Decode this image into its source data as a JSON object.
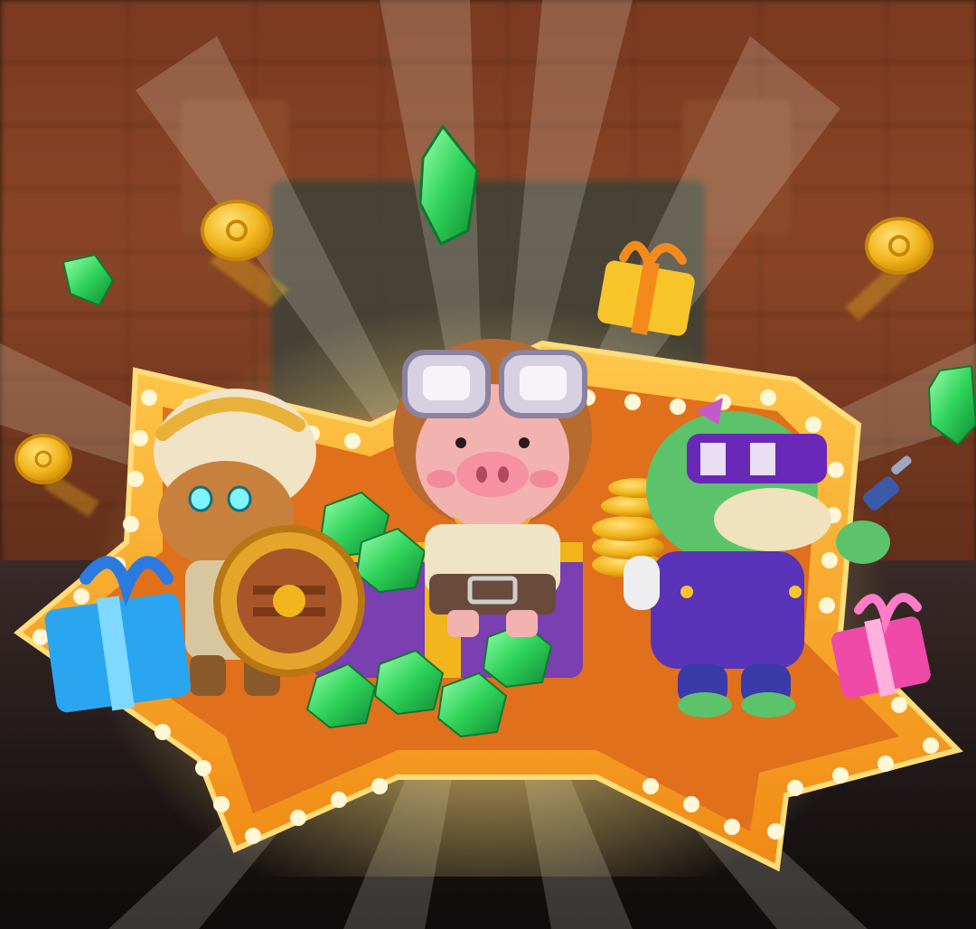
{
  "scene": {
    "theme": "game-promo-banner",
    "characters": [
      {
        "id": "warrior",
        "icon": "laurel-warrior-icon",
        "accent": "#e8b23a"
      },
      {
        "id": "pig-pilot",
        "icon": "pig-aviator-icon",
        "accent": "#f2a0a8"
      },
      {
        "id": "crocodile",
        "icon": "crocodile-sunglasses-icon",
        "accent": "#5cc36a"
      }
    ],
    "colors": {
      "star_frame": "#f5a623",
      "star_inner": "#e0701c",
      "bulb": "#fff7d6",
      "gem": "#2fd35a",
      "coin": "#f2b51c",
      "gift_blue": "#2aa6f0",
      "gift_pink": "#f04aa8",
      "gift_yellow": "#f7c52a"
    }
  }
}
